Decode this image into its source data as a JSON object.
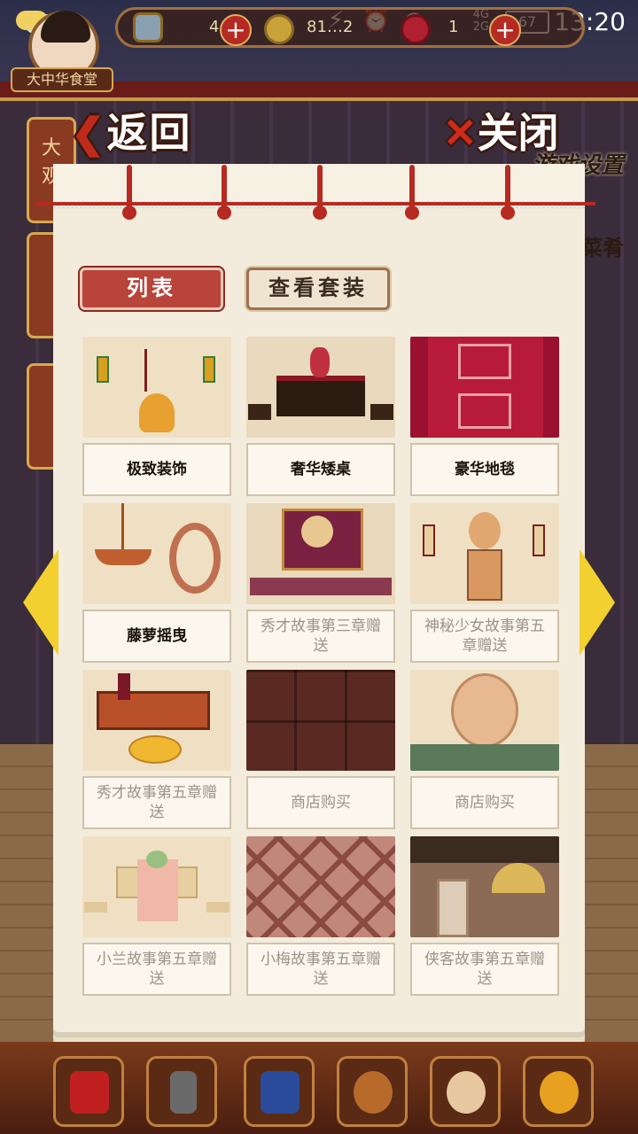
{
  "status_bar": {
    "time": "13:20",
    "battery": "67",
    "network_top": "4G",
    "network_bottom": "2G"
  },
  "header": {
    "shop_name": "大中华食堂",
    "resources": [
      {
        "value": "4"
      },
      {
        "value": "81…2"
      },
      {
        "value": "1"
      }
    ]
  },
  "nav": {
    "back_label": "返回",
    "close_label": "关闭",
    "settings_label": "游戏设置",
    "side_tabs": [
      "大观",
      "",
      ""
    ],
    "side_right_label": "菜肴"
  },
  "tabs": {
    "list_label": "列表",
    "sets_label": "查看套装"
  },
  "items": [
    {
      "label": "极致装饰",
      "owned": true,
      "art": "decor"
    },
    {
      "label": "奢华矮桌",
      "owned": true,
      "art": "table"
    },
    {
      "label": "豪华地毯",
      "owned": true,
      "art": "carpet"
    },
    {
      "label": "藤萝摇曳",
      "owned": true,
      "art": "chand"
    },
    {
      "label": "秀才故事第三章赠送",
      "owned": false,
      "art": "throne"
    },
    {
      "label": "神秘少女故事第五章赠送",
      "owned": false,
      "art": "fox"
    },
    {
      "label": "秀才故事第五章赠送",
      "owned": false,
      "art": "couch"
    },
    {
      "label": "商店购买",
      "owned": false,
      "art": "tile"
    },
    {
      "label": "商店购买",
      "owned": false,
      "art": "moon"
    },
    {
      "label": "小兰故事第五章赠送",
      "owned": false,
      "art": "bench"
    },
    {
      "label": "小梅故事第五章赠送",
      "owned": false,
      "art": "diamond"
    },
    {
      "label": "侠客故事第五章赠送",
      "owned": false,
      "art": "room"
    }
  ],
  "colors": {
    "accent_red": "#b62a22",
    "paper": "#f3ecdc",
    "arrow_yellow": "#f2d030"
  },
  "icons": [
    "prev-page-icon",
    "next-page-icon",
    "gift-box-icon",
    "hammer-icon",
    "book-icon",
    "pot-icon",
    "chef-icon",
    "wok-icon"
  ]
}
